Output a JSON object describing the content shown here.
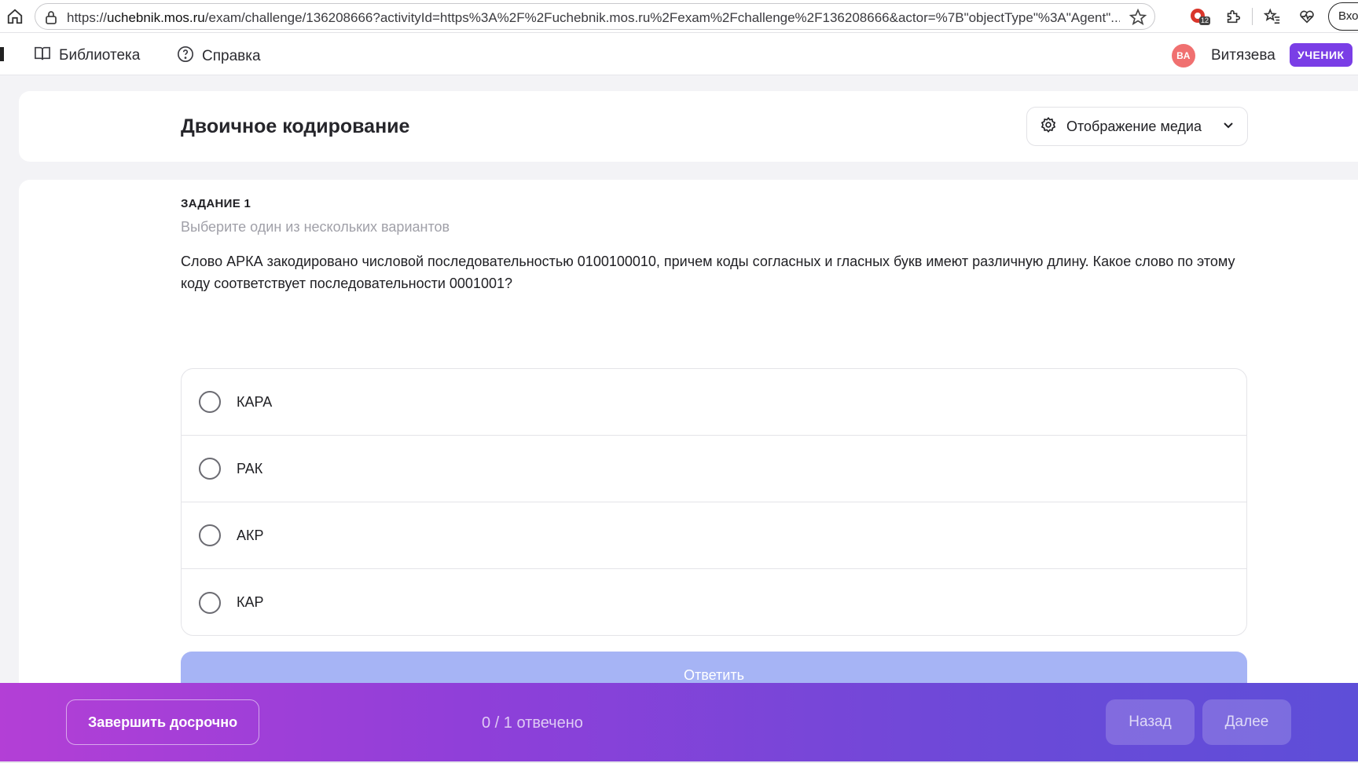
{
  "browser": {
    "url_prefix": "https://",
    "url_host": "uchebnik.mos.ru",
    "url_rest": "/exam/challenge/136208666?activityId=https%3A%2F%2Fuchebnik.mos.ru%2Fexam%2Fchallenge%2F136208666&actor=%7B\"objectType\"%3A\"Agent\"...",
    "extension_badge": "12",
    "login_label": "Вхо"
  },
  "nav": {
    "library_label": "Библиотека",
    "help_label": "Справка",
    "avatar_initials": "ВА",
    "user_name": "Витязева",
    "role_badge": "УЧЕНИК"
  },
  "header": {
    "title": "Двоичное кодирование",
    "media_label": "Отображение медиа"
  },
  "task": {
    "number_label": "ЗАДАНИЕ 1",
    "hint": "Выберите один из нескольких вариантов",
    "question": "Слово АРКА закодировано числовой последовательностью 0100100010, причем коды согласных и гласных букв имеют различную длину. Какое слово по этому коду соответствует последовательности 0001001?",
    "options": [
      {
        "label": "КАРА"
      },
      {
        "label": "РАК"
      },
      {
        "label": "АКР"
      },
      {
        "label": "КАР"
      }
    ],
    "submit_label": "Ответить"
  },
  "footer": {
    "finish_label": "Завершить досрочно",
    "progress_text": "0 / 1 отвечено",
    "back_label": "Назад",
    "next_label": "Далее"
  }
}
